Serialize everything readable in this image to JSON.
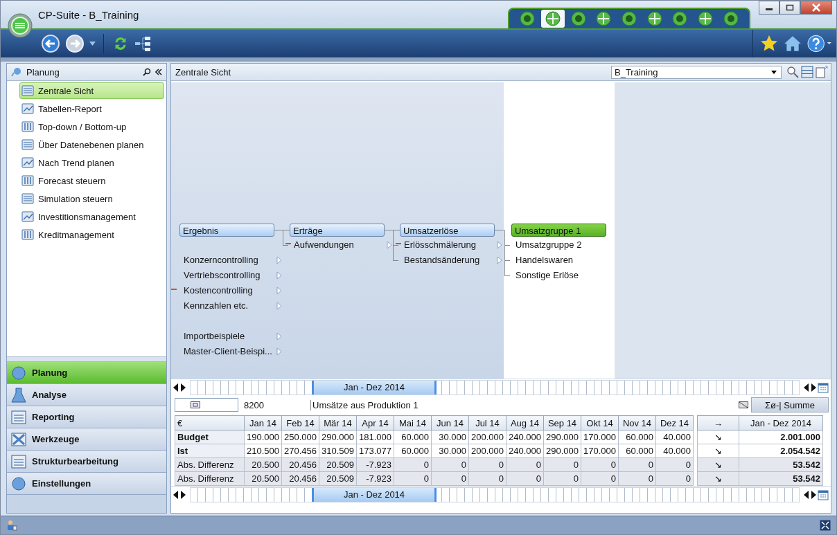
{
  "window": {
    "title": "CP-Suite - B_Training"
  },
  "module_tabs": [
    {
      "selected": false
    },
    {
      "selected": true
    },
    {
      "selected": false
    },
    {
      "selected": false
    },
    {
      "selected": false
    },
    {
      "selected": false
    },
    {
      "selected": false
    },
    {
      "selected": false
    },
    {
      "selected": false
    }
  ],
  "left_panel": {
    "title": "Planung",
    "items": [
      {
        "label": "Zentrale Sicht",
        "selected": true
      },
      {
        "label": "Tabellen-Report",
        "selected": false
      },
      {
        "label": "Top-down / Bottom-up",
        "selected": false
      },
      {
        "label": "Über Datenebenen planen",
        "selected": false
      },
      {
        "label": "Nach Trend planen",
        "selected": false
      },
      {
        "label": "Forecast steuern",
        "selected": false
      },
      {
        "label": "Simulation steuern",
        "selected": false
      },
      {
        "label": "Investitionsmanagement",
        "selected": false
      },
      {
        "label": "Kreditmanagement",
        "selected": false
      }
    ]
  },
  "nav_sections": [
    {
      "label": "Planung",
      "selected": true
    },
    {
      "label": "Analyse",
      "selected": false
    },
    {
      "label": "Reporting",
      "selected": false
    },
    {
      "label": "Werkzeuge",
      "selected": false
    },
    {
      "label": "Strukturbearbeitung",
      "selected": false
    },
    {
      "label": "Einstellungen",
      "selected": false
    }
  ],
  "main": {
    "title": "Zentrale Sicht",
    "dataset": "B_Training"
  },
  "tree": {
    "columns": [
      {
        "node": {
          "label": "Ergebnis",
          "selected": false
        },
        "groups": [
          {
            "items": [
              {
                "label": "Konzerncontrolling",
                "marked": false,
                "has_children": true
              },
              {
                "label": "Vertriebscontrolling",
                "marked": false,
                "has_children": true
              },
              {
                "label": "Kostencontrolling",
                "marked": true,
                "has_children": true
              },
              {
                "label": "Kennzahlen etc.",
                "marked": false,
                "has_children": true
              }
            ]
          },
          {
            "items": [
              {
                "label": "Importbeispiele",
                "marked": false,
                "has_children": true
              },
              {
                "label": "Master-Client-Beispi...",
                "marked": false,
                "has_children": true
              }
            ]
          }
        ]
      },
      {
        "node": {
          "label": "Erträge",
          "selected": false
        },
        "groups": [
          {
            "items": [
              {
                "label": "Aufwendungen",
                "marked": true,
                "has_children": true
              }
            ]
          }
        ]
      },
      {
        "node": {
          "label": "Umsatzerlöse",
          "selected": false
        },
        "groups": [
          {
            "items": [
              {
                "label": "Erlösschmälerung",
                "marked": true,
                "has_children": true
              },
              {
                "label": "Bestandsänderung",
                "marked": false,
                "has_children": true
              }
            ]
          }
        ]
      },
      {
        "node": {
          "label": "Umsatzgruppe 1",
          "selected": true
        },
        "groups": [
          {
            "items": [
              {
                "label": "Umsatzgruppe 2",
                "marked": false,
                "has_children": false
              },
              {
                "label": "Handelswaren",
                "marked": false,
                "has_children": false
              },
              {
                "label": "Sonstige Erlöse",
                "marked": false,
                "has_children": false
              }
            ]
          }
        ]
      }
    ]
  },
  "timelines": [
    {
      "range": "Jan - Dez 2014"
    },
    {
      "range": "Jan - Dez 2014"
    }
  ],
  "account": {
    "number": "8200",
    "name": "Umsätze aus Produktion 1",
    "sum_button": "Σø-| Summe"
  },
  "table": {
    "corner": "€",
    "columns": [
      "Jan 14",
      "Feb 14",
      "Mär 14",
      "Apr 14",
      "Mai 14",
      "Jun 14",
      "Jul 14",
      "Aug 14",
      "Sep 14",
      "Okt 14",
      "Nov 14",
      "Dez 14"
    ],
    "rows": [
      {
        "label": "Budget",
        "bold": true,
        "shaded": false,
        "values": [
          "190.000",
          "250.000",
          "290.000",
          "181.000",
          "60.000",
          "30.000",
          "200.000",
          "240.000",
          "290.000",
          "170.000",
          "60.000",
          "40.000"
        ]
      },
      {
        "label": "Ist",
        "bold": true,
        "shaded": false,
        "values": [
          "210.500",
          "270.456",
          "310.509",
          "173.077",
          "60.000",
          "30.000",
          "200.000",
          "240.000",
          "290.000",
          "170.000",
          "60.000",
          "40.000"
        ]
      },
      {
        "label": "Abs. Differenz",
        "bold": false,
        "shaded": true,
        "values": [
          "20.500",
          "20.456",
          "20.509",
          "-7.923",
          "0",
          "0",
          "0",
          "0",
          "0",
          "0",
          "0",
          "0"
        ]
      },
      {
        "label": "Abs. Differenz",
        "bold": false,
        "shaded": true,
        "values": [
          "20.500",
          "20.456",
          "20.509",
          "-7.923",
          "0",
          "0",
          "0",
          "0",
          "0",
          "0",
          "0",
          "0"
        ]
      }
    ]
  },
  "totals": {
    "arrow_header": "→",
    "header": "Jan - Dez 2014",
    "rows": [
      {
        "arrow": "↘",
        "value": "2.001.000"
      },
      {
        "arrow": "↘",
        "value": "2.054.542"
      },
      {
        "arrow": "↘",
        "value": "53.542"
      },
      {
        "arrow": "↘",
        "value": "53.542"
      }
    ]
  }
}
